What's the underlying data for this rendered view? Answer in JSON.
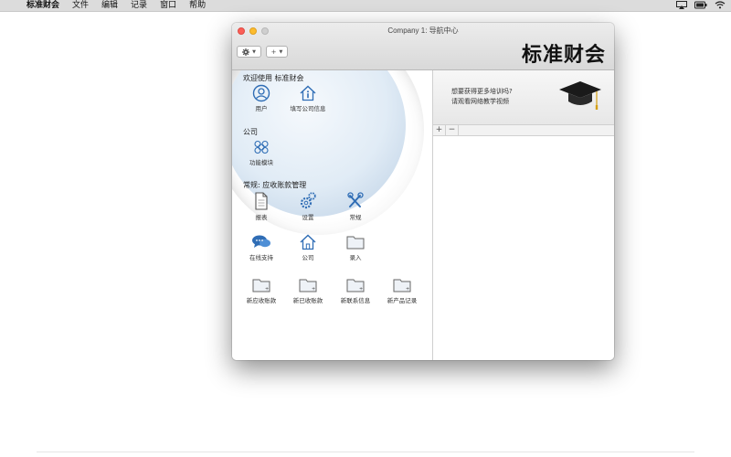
{
  "menubar": {
    "app_name": "标准财会",
    "items": [
      "文件",
      "编辑",
      "记录",
      "窗口",
      "帮助"
    ]
  },
  "window": {
    "title": "Company 1: 导航中心",
    "brand": "标准财会",
    "toolbar": {
      "add_label": "+"
    }
  },
  "sections": {
    "welcome": "欢迎使用 标准财会",
    "company": "公司",
    "routine": "常规: 应收账款管理"
  },
  "icons": {
    "user": "用户",
    "company_info": "填写公司信息",
    "modules": "功能模块",
    "reports": "报表",
    "settings": "设置",
    "routine": "常规",
    "online_support": "在线支持",
    "company": "公司",
    "entry": "录入",
    "new_receivable": "新应收账款",
    "new_received": "新已收账款",
    "new_contact": "新联系信息",
    "new_product": "新产品记录"
  },
  "training": {
    "line1": "想要获得更多培训吗?",
    "line2": "请观看网络教学视频"
  },
  "list_controls": {
    "add": "+",
    "remove": "−"
  },
  "colors": {
    "icon_blue": "#2f6db5",
    "close": "#fc5f57",
    "minimize": "#fdbc2e"
  }
}
